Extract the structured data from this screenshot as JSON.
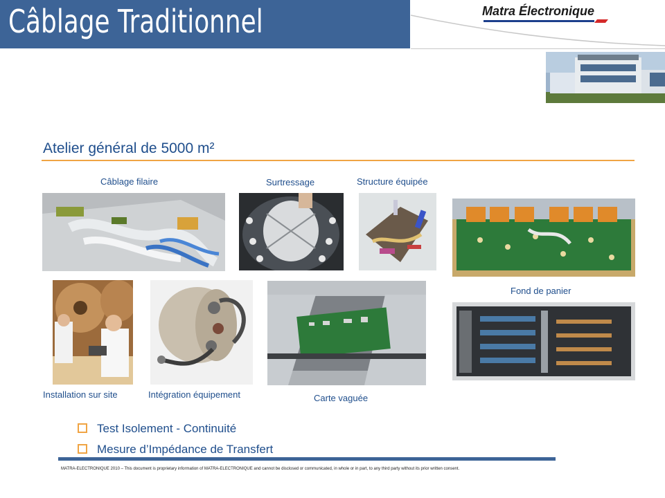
{
  "header": {
    "title": "Câblage Traditionnel",
    "logo_text": "Matra Électronique"
  },
  "section": {
    "title": "Atelier général de 5000 m²"
  },
  "captions": {
    "cablage_filaire": "Câblage filaire",
    "surtressage": "Surtressage",
    "structure_equipee": "Structure  équipée",
    "fond_de_panier": "Fond de panier",
    "installation": "Installation sur site",
    "integration": "Intégration équipement",
    "carte_vaguee": "Carte vaguée"
  },
  "bullets": [
    "Test Isolement - Continuité",
    "Mesure d’Impédance de Transfert"
  ],
  "footer": {
    "text": "MATRA-ELECTRONIQUE 2010 – This document is proprietary information of MATRA-ELECTRONIQUE and cannot be disclosed or communicated, in whole or in part, to any third party without its prior written consent."
  },
  "colors": {
    "title_bar": "#3d6497",
    "accent_orange": "#f0a443",
    "caption_blue": "#1f4e8c"
  }
}
